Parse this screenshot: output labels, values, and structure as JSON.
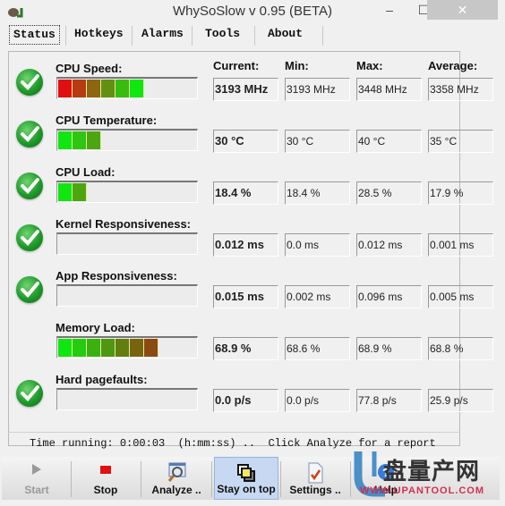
{
  "window": {
    "title": "WhySoSlow v 0.95  (BETA)",
    "icon": "snail-icon",
    "controls": {
      "minimize": "–",
      "maximize": "☐",
      "close": "✕"
    }
  },
  "tabs": [
    {
      "label": "Status",
      "active": true
    },
    {
      "label": "Hotkeys",
      "active": false
    },
    {
      "label": "Alarms",
      "active": false
    },
    {
      "label": "Tools",
      "active": false
    },
    {
      "label": "About",
      "active": false
    }
  ],
  "columns": {
    "current": "Current:",
    "min": "Min:",
    "max": "Max:",
    "average": "Average:"
  },
  "metrics": [
    {
      "label": "CPU Speed:",
      "status": "ok",
      "level_segments": 6,
      "current": "3193 MHz",
      "min": "3193 MHz",
      "max": "3448 MHz",
      "average": "3358 MHz"
    },
    {
      "label": "CPU Temperature:",
      "status": "ok",
      "level_segments": 3,
      "current": "30 °C",
      "min": "30 °C",
      "max": "40 °C",
      "average": "35 °C"
    },
    {
      "label": "CPU Load:",
      "status": "ok",
      "level_segments": 2,
      "current": "18.4 %",
      "min": "18.4 %",
      "max": "28.5 %",
      "average": "17.9 %"
    },
    {
      "label": "Kernel Responsiveness:",
      "status": "ok",
      "level_segments": 0,
      "current": "0.012 ms",
      "min": "0.0 ms",
      "max": "0.012 ms",
      "average": "0.001 ms"
    },
    {
      "label": "App Responsiveness:",
      "status": "ok",
      "level_segments": 0,
      "current": "0.015 ms",
      "min": "0.002 ms",
      "max": "0.096 ms",
      "average": "0.005 ms"
    },
    {
      "label": "Memory Load:",
      "status": "none",
      "level_segments": 7,
      "current": "68.9 %",
      "min": "68.6 %",
      "max": "68.9 %",
      "average": "68.8 %"
    },
    {
      "label": "Hard pagefaults:",
      "status": "ok",
      "level_segments": 0,
      "current": "0.0 p/s",
      "min": "0.0 p/s",
      "max": "77.8 p/s",
      "average": "25.9 p/s"
    }
  ],
  "status_text": "Time running: 0:00:03  (h:mm:ss) ..  Click Analyze for a report",
  "toolbar": [
    {
      "label": "Start",
      "icon": "play-icon",
      "disabled": true
    },
    {
      "label": "Stop",
      "icon": "stop-icon"
    },
    {
      "label": "Analyze ..",
      "icon": "analyze-icon"
    },
    {
      "label": "Stay on top",
      "icon": "stay-on-top-icon",
      "pressed": true
    },
    {
      "label": "Settings ..",
      "icon": "settings-icon"
    },
    {
      "label": "Help",
      "icon": "help-icon"
    }
  ],
  "watermark": {
    "text_cn": "盘量产网",
    "text_url": "WWW.UPANTOOL.COM"
  },
  "colors": {
    "ok_green": "#1f9a2a",
    "bar_red": "#e01010",
    "bar_green": "#10e010",
    "bar_brown": "#8a4a10"
  }
}
